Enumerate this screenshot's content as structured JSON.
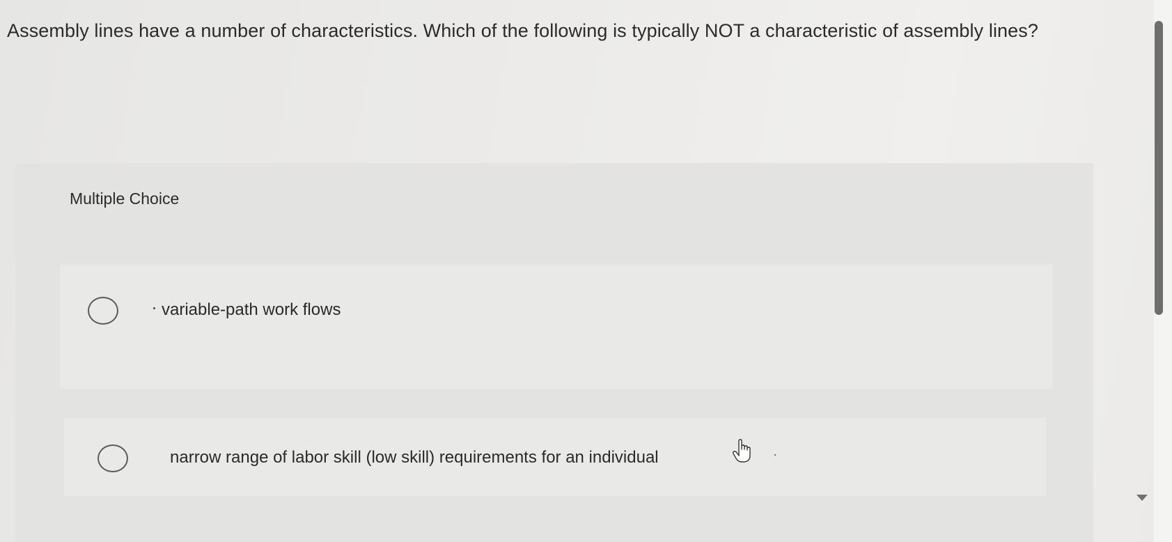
{
  "question": {
    "text": "Assembly lines have a number of characteristics. Which of the following is typically NOT a characteristic of assembly lines?"
  },
  "multiple_choice": {
    "label": "Multiple Choice",
    "options": [
      {
        "text": "variable-path work flows",
        "selected": false
      },
      {
        "text": "narrow range of labor skill (low skill) requirements for an individual",
        "selected": false
      }
    ]
  },
  "icons": {
    "cursor": "hand-pointer-icon",
    "radio": "radio-unchecked-icon",
    "scroll_down": "triangle-down-icon"
  },
  "colors": {
    "background": "#ebeae8",
    "panel": "#e3e3e1",
    "option_card": "#e9e9e7",
    "text": "#2b2b2b",
    "scroll_thumb": "#6e6e6e"
  }
}
